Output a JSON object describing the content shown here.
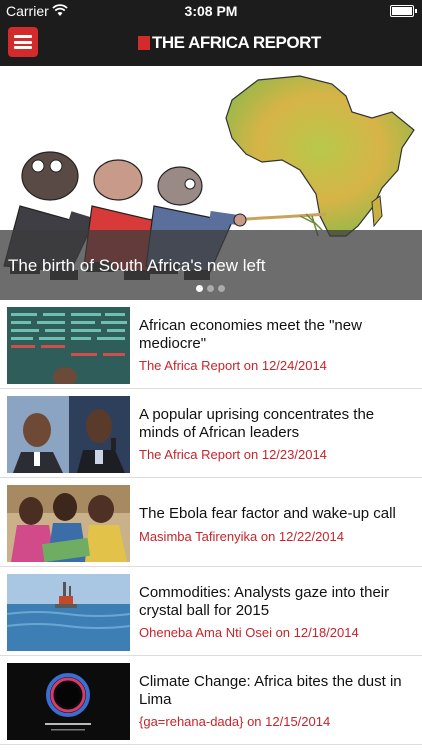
{
  "status_bar": {
    "carrier": "Carrier",
    "time": "3:08 PM"
  },
  "nav": {
    "brand": "THE AFRICA REPORT"
  },
  "hero": {
    "caption": "The birth of South Africa's new left",
    "page_count": 3,
    "active_page": 0
  },
  "articles": [
    {
      "title": "African economies meet the \"new mediocre\"",
      "meta": "The Africa Report on 12/24/2014"
    },
    {
      "title": "A popular uprising concentrates the minds of African leaders",
      "meta": "The Africa Report on 12/23/2014"
    },
    {
      "title": "The Ebola fear factor and wake-up call",
      "meta": "Masimba Tafirenyika on 12/22/2014"
    },
    {
      "title": "Commodities: Analysts gaze into their crystal ball for 2015",
      "meta": "Oheneba Ama Nti Osei on 12/18/2014"
    },
    {
      "title": "Climate Change: Africa bites the dust in Lima",
      "meta": "{ga=rehana-dada} on 12/15/2014"
    }
  ],
  "colors": {
    "accent": "#d32b2b",
    "meta_text": "#c8242b",
    "bar_bg": "#1c1c1c"
  }
}
